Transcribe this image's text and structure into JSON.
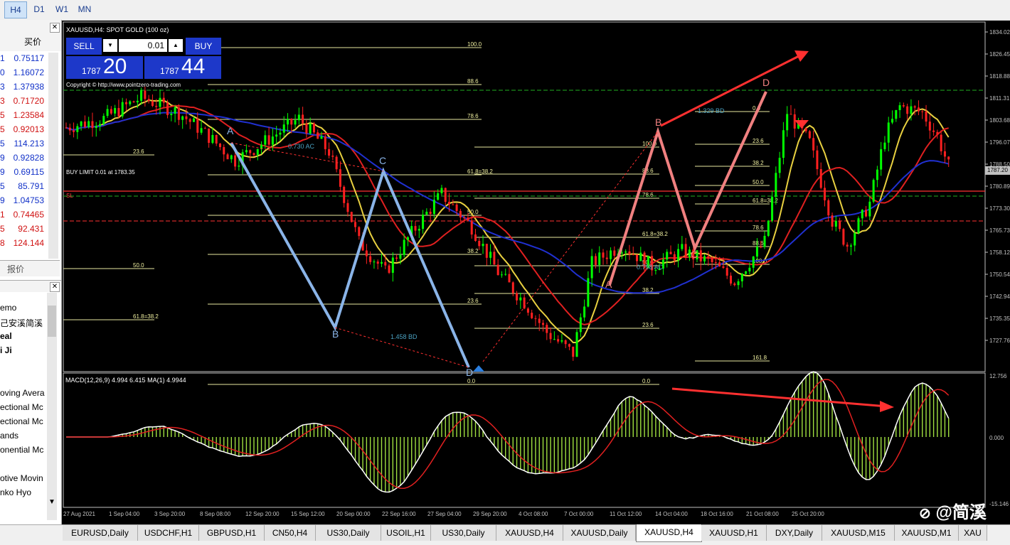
{
  "timeframes": [
    "H4",
    "D1",
    "W1",
    "MN"
  ],
  "active_timeframe": "H4",
  "market_watch": {
    "column_label": "买价",
    "rows": [
      {
        "ch": "1",
        "value": "0.75117",
        "dir": "up"
      },
      {
        "ch": "0",
        "value": "1.16072",
        "dir": "up"
      },
      {
        "ch": "3",
        "value": "1.37938",
        "dir": "up"
      },
      {
        "ch": "3",
        "value": "0.71720",
        "dir": "dn"
      },
      {
        "ch": "5",
        "value": "1.23584",
        "dir": "dn"
      },
      {
        "ch": "5",
        "value": "0.92013",
        "dir": "dn"
      },
      {
        "ch": "5",
        "value": "114.213",
        "dir": "up"
      },
      {
        "ch": "9",
        "value": "0.92828",
        "dir": "up"
      },
      {
        "ch": "9",
        "value": "0.69115",
        "dir": "up"
      },
      {
        "ch": "5",
        "value": "85.791",
        "dir": "up"
      },
      {
        "ch": "9",
        "value": "1.04753",
        "dir": "up"
      },
      {
        "ch": "1",
        "value": "0.74465",
        "dir": "dn"
      },
      {
        "ch": "5",
        "value": "92.431",
        "dir": "dn"
      },
      {
        "ch": "8",
        "value": "124.144",
        "dir": "dn"
      }
    ],
    "tab_label": "报价"
  },
  "navigator": {
    "items": [
      {
        "label": "emo",
        "bold": false
      },
      {
        "label": "己安溪简溪",
        "bold": false
      },
      {
        "label": "eal",
        "bold": true
      },
      {
        "label": "i Ji",
        "bold": true
      },
      {
        "label": "oving Avera",
        "bold": false
      },
      {
        "label": "ectional Mc",
        "bold": false
      },
      {
        "label": "ectional Mc",
        "bold": false
      },
      {
        "label": "ands",
        "bold": false
      },
      {
        "label": "onential Mc",
        "bold": false
      },
      {
        "label": "otive Movin",
        "bold": false
      },
      {
        "label": "nko Hyo",
        "bold": false
      }
    ]
  },
  "chart": {
    "symbol_title": "XAUUSD,H4: SPOT GOLD (100 oz)",
    "copyright": "Copyright © http://www.pointzero-trading.com",
    "trade_panel": {
      "sell": "SELL",
      "buy": "BUY",
      "lot": "0.01",
      "sell_big": "1787",
      "sell_small": "20",
      "buy_big": "1787",
      "buy_small": "44"
    },
    "buy_limit_label": "BUY LIMIT 0.01 at 1783.35",
    "sl_label": "SL",
    "price_axis": [
      "1834.02",
      "1826.45",
      "1818.88",
      "1811.31",
      "1803.68",
      "1796.07",
      "1788.50",
      "1780.89",
      "1773.30",
      "1765.73",
      "1758.12",
      "1750.54",
      "1742.94",
      "1735.35",
      "1727.76"
    ],
    "current_price": "1787.20",
    "macd_label": "MACD(12,26,9) 4.994 6.415 MA(1) 4.9944",
    "macd_axis": [
      "12.756",
      "0.000",
      "-15.146"
    ],
    "time_axis": [
      "27 Aug 2021",
      "1 Sep 04:00",
      "3 Sep 20:00",
      "8 Sep 08:00",
      "12 Sep 20:00",
      "15 Sep 12:00",
      "20 Sep 00:00",
      "22 Sep 16:00",
      "27 Sep 04:00",
      "29 Sep 20:00",
      "4 Oct 08:00",
      "7 Oct 00:00",
      "11 Oct 12:00",
      "14 Oct 04:00",
      "18 Oct 16:00",
      "21 Oct 08:00",
      "25 Oct 20:00"
    ],
    "pattern1": {
      "points": [
        "A",
        "B",
        "C",
        "D"
      ],
      "fib_labels": [
        "100.0",
        "88.6",
        "78.6",
        "61.8=38.2",
        "50.0",
        "38.2",
        "23.6",
        "0.0",
        "23.6",
        "50.0",
        "61.8=38.2"
      ],
      "ratio": "1.458 BD",
      "ratio2": "0.730 AC"
    },
    "pattern2": {
      "points": [
        "A",
        "B",
        "C",
        "D"
      ],
      "fib_labels": [
        "100.0",
        "88.6",
        "78.6",
        "61.8=38.2",
        "50.0",
        "38.2",
        "23.6",
        "0.0",
        "61.8=38.2",
        "38.2",
        "50.0",
        "23.6",
        "0.0",
        "78.6",
        "88.6",
        "100.0",
        "161.8"
      ],
      "ratio": "1.329 BD",
      "ratio2": "0.798 AC"
    },
    "watermark": "@简溪"
  },
  "symbol_tabs": [
    "EURUSD,Daily",
    "USDCHF,H1",
    "GBPUSD,H1",
    "CN50,H4",
    "US30,Daily",
    "USOIL,H1",
    "US30,Daily",
    "XAUUSD,H4",
    "XAUUSD,Daily",
    "XAUUSD,H4",
    "XAUUSD,H1",
    "DXY,Daily",
    "XAUUSD,M15",
    "XAUUSD,M1",
    "XAU"
  ],
  "active_symbol_tab": 9,
  "colors": {
    "bg": "#000000",
    "bull": "#00ff00",
    "bear": "#ff2020",
    "ma_yellow": "#e8d040",
    "ma_red": "#e02020",
    "ma_blue": "#2030d0",
    "pattern1": "#8ab4e8",
    "pattern2": "#f08080",
    "arrow": "#ff3030"
  }
}
